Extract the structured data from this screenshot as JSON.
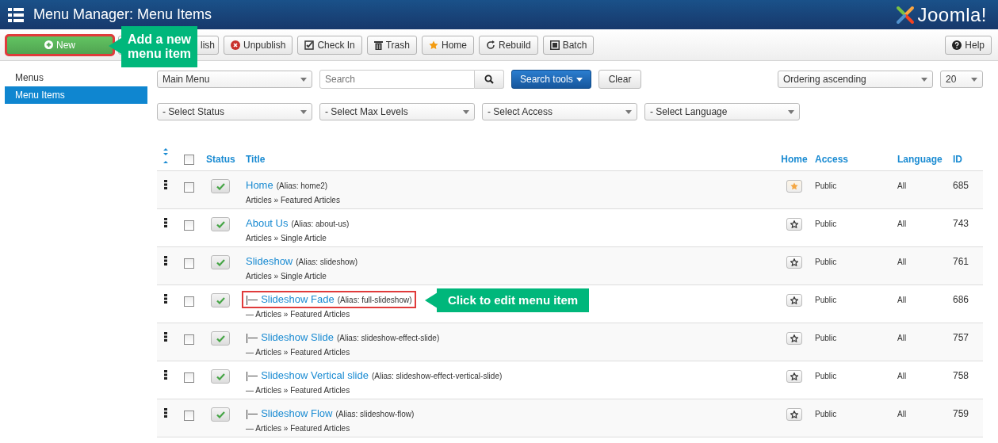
{
  "header": {
    "title": "Menu Manager: Menu Items",
    "logo": "Joomla!"
  },
  "toolbar": {
    "buttons": [
      {
        "kind": "new",
        "label": "New",
        "highlighted": true
      },
      {
        "kind": "covered",
        "label": "lish"
      },
      {
        "kind": "unpublish",
        "label": "Unpublish"
      },
      {
        "kind": "checkin",
        "label": "Check In"
      },
      {
        "kind": "trash",
        "label": "Trash"
      },
      {
        "kind": "home",
        "label": "Home"
      },
      {
        "kind": "rebuild",
        "label": "Rebuild"
      },
      {
        "kind": "batch",
        "label": "Batch"
      }
    ],
    "help": "Help"
  },
  "sidebar": {
    "items": [
      {
        "label": "Menus",
        "selected": false
      },
      {
        "label": "Menu Items",
        "selected": true
      }
    ]
  },
  "filters": {
    "menu": "Main Menu",
    "search_placeholder": "Search",
    "search_tools": "Search tools",
    "clear": "Clear",
    "ordering": "Ordering ascending",
    "limit": "20",
    "selects": [
      "- Select Status",
      "- Select Max Levels",
      "- Select Access",
      "- Select Language"
    ]
  },
  "table": {
    "select_all_checked": false,
    "columns": [
      "Status",
      "Title",
      "Home",
      "Access",
      "Language",
      "ID"
    ],
    "rows": [
      {
        "prefix": "",
        "title": "Home",
        "alias": "(Alias: home2)",
        "type_prefix": "",
        "type": "Articles » Featured Articles",
        "checked": false,
        "published": true,
        "home": true,
        "access": "Public",
        "language": "All",
        "id": "685",
        "highlighted": false
      },
      {
        "prefix": "",
        "title": "About Us",
        "alias": "(Alias: about-us)",
        "type_prefix": "",
        "type": "Articles » Single Article",
        "checked": false,
        "published": true,
        "home": false,
        "access": "Public",
        "language": "All",
        "id": "743",
        "highlighted": false
      },
      {
        "prefix": "",
        "title": "Slideshow",
        "alias": "(Alias: slideshow)",
        "type_prefix": "",
        "type": "Articles » Single Article",
        "checked": false,
        "published": true,
        "home": false,
        "access": "Public",
        "language": "All",
        "id": "761",
        "highlighted": false
      },
      {
        "prefix": "|—",
        "title": "Slideshow Fade",
        "alias": "(Alias: full-slideshow)",
        "type_prefix": "—",
        "type": "Articles » Featured Articles",
        "checked": false,
        "published": true,
        "home": false,
        "access": "Public",
        "language": "All",
        "id": "686",
        "highlighted": true
      },
      {
        "prefix": "|—",
        "title": "Slideshow Slide",
        "alias": "(Alias: slideshow-effect-slide)",
        "type_prefix": "—",
        "type": "Articles » Featured Articles",
        "checked": false,
        "published": true,
        "home": false,
        "access": "Public",
        "language": "All",
        "id": "757",
        "highlighted": false
      },
      {
        "prefix": "|—",
        "title": "Slideshow Vertical slide",
        "alias": "(Alias: slideshow-effect-vertical-slide)",
        "type_prefix": "—",
        "type": "Articles » Featured Articles",
        "checked": false,
        "published": true,
        "home": false,
        "access": "Public",
        "language": "All",
        "id": "758",
        "highlighted": false
      },
      {
        "prefix": "|—",
        "title": "Slideshow Flow",
        "alias": "(Alias: slideshow-flow)",
        "type_prefix": "—",
        "type": "Articles » Featured Articles",
        "checked": false,
        "published": true,
        "home": false,
        "access": "Public",
        "language": "All",
        "id": "759",
        "highlighted": false
      }
    ]
  },
  "callouts": [
    {
      "kind": "toolbar",
      "text": "Add a new menu item"
    },
    {
      "kind": "row",
      "text": "Click to edit menu item"
    }
  ]
}
